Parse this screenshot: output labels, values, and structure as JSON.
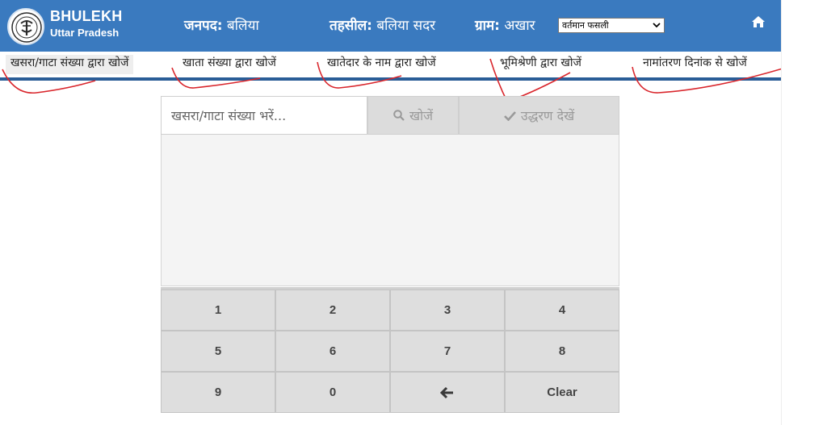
{
  "brand": {
    "title": "BHULEKH",
    "subtitle": "Uttar Pradesh"
  },
  "header": {
    "janpad_label": "जनपद:",
    "janpad_value": "बलिया",
    "tehsil_label": "तहसील:",
    "tehsil_value": "बलिया सदर",
    "gram_label": "ग्राम:",
    "gram_value": "अखार",
    "season_selected": "वर्तमान फसली"
  },
  "tabs": [
    {
      "label": "खसरा/गाटा संख्या द्वारा खोजें",
      "active": true
    },
    {
      "label": "खाता संख्या द्वारा खोजें"
    },
    {
      "label": "खातेदार के नाम द्वारा खोजें"
    },
    {
      "label": "भूमिश्रेणी द्वारा खोजें"
    },
    {
      "label": "नामांतरण दिनांक से खोजें"
    }
  ],
  "search": {
    "placeholder": "खसरा/गाटा संख्या भरें...",
    "search_label": "खोजें",
    "view_label": "उद्धरण देखें"
  },
  "keypad": [
    "1",
    "2",
    "3",
    "4",
    "5",
    "6",
    "7",
    "8",
    "9",
    "0",
    "←",
    "Clear"
  ],
  "icons": {
    "home": "home-icon",
    "search": "search-icon",
    "check": "check-icon",
    "backspace": "arrow-left-icon"
  },
  "colors": {
    "header_bg": "#3a7abf",
    "tab_underline": "#2a5d97",
    "annotation_red": "#d9262c"
  }
}
